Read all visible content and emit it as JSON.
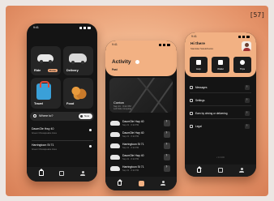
{
  "page": {
    "number": "[57]"
  },
  "status": {
    "time": "9:41"
  },
  "phone1": {
    "tiles": [
      {
        "label": "Ride",
        "badge": ""
      },
      {
        "label": "Delivery",
        "badge": ""
      },
      {
        "label": "Travel",
        "badge": ""
      },
      {
        "label": "Food",
        "badge": ""
      }
    ],
    "ride_badge": "Promo",
    "search": {
      "placeholder": "Where to?",
      "now_label": "Now"
    },
    "places": [
      {
        "title": "DaumOle Hwy 40",
        "sub": "Green Chesapeake Area"
      },
      {
        "title": "Harringtoon St 71",
        "sub": "Green Chesapeake Area"
      }
    ],
    "tabs": [
      "home",
      "activity",
      "account"
    ]
  },
  "phone2": {
    "title": "Activity",
    "subtitle": "Past",
    "map_card": {
      "title": "Conton",
      "sub": "Sep 21 · 6:22 PM",
      "sub2": "Left Side Complete"
    },
    "rides": [
      {
        "title": "DaumOle Hwy 40",
        "sub": "Sep 21 · 6:22 PM"
      },
      {
        "title": "DaumOle Hwy 40",
        "sub": "Sep 21 · 6:22 PM"
      },
      {
        "title": "Harringtoon St 71",
        "sub": "Sep 21 · 6:22 PM"
      },
      {
        "title": "DaumOle Hwy 40",
        "sub": "Sep 21 · 6:22 PM"
      },
      {
        "title": "Harringtoon St 71",
        "sub": "Sep 21 · 6:22 PM"
      }
    ]
  },
  "phone3": {
    "greeting": "Hi there",
    "name": "Stanislav Sokolchenko",
    "quick": [
      "Help",
      "Wallet",
      "Trips"
    ],
    "menu": [
      "Messages",
      "Settings",
      "Earn by driving or delivering",
      "Legal"
    ],
    "footer": "v 4.3.000"
  },
  "colors": {
    "accent": "#f2b183",
    "phone_bg": "#141414",
    "tile_bg": "#252525"
  }
}
